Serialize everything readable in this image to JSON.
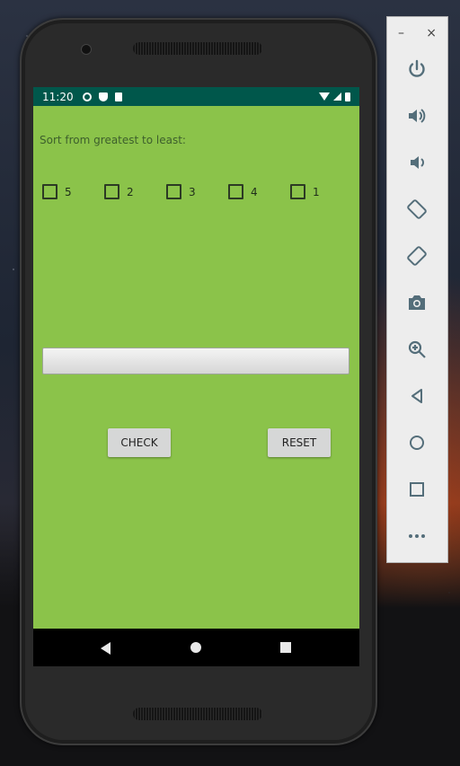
{
  "status": {
    "time": "11:20"
  },
  "app": {
    "prompt": "Sort from greatest to least:",
    "options": [
      "5",
      "2",
      "3",
      "4",
      "1"
    ],
    "answer_value": "",
    "check_label": "CHECK",
    "reset_label": "RESET"
  },
  "toolbar": {
    "minimize_label": "–",
    "close_label": "×",
    "icons": [
      "power-icon",
      "volume-up-icon",
      "volume-down-icon",
      "rotate-left-icon",
      "rotate-right-icon",
      "camera-icon",
      "zoom-icon",
      "back-icon",
      "home-icon",
      "overview-icon",
      "more-icon"
    ]
  },
  "colors": {
    "app_bg": "#8bc34a",
    "status_bar": "#00574b",
    "toolbar_icon": "#546e7a"
  }
}
